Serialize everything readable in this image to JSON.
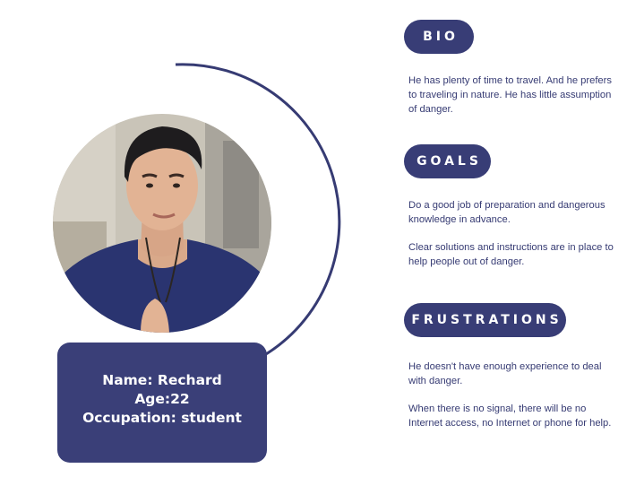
{
  "profile": {
    "name_line": "Name: Rechard",
    "age_line": "Age:22",
    "occupation_line": "Occupation: student"
  },
  "sections": {
    "bio": {
      "title": "BIO",
      "text": "He has plenty of time to travel. And he prefers to traveling in nature. He has little assumption of danger."
    },
    "goals": {
      "title": "GOALS",
      "text_1": "Do a good job of preparation and dangerous knowledge in advance.",
      "text_2": "Clear solutions and instructions are in place to help people out of danger."
    },
    "frustrations": {
      "title": "FRUSTRATIONS",
      "text_1": "He doesn't have enough experience to deal with danger.",
      "text_2": "When there is no signal, there will be no Internet access, no Internet or phone for help."
    }
  },
  "colors": {
    "accent": "#383d76",
    "text": "#363b73",
    "background": "#ffffff"
  }
}
